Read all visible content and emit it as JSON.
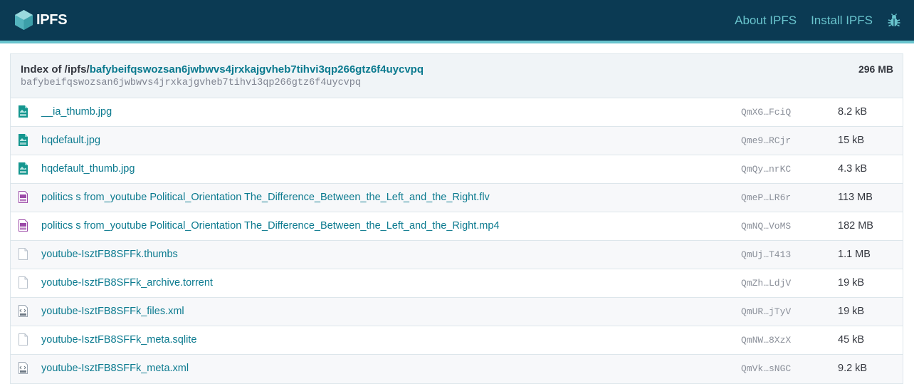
{
  "header": {
    "brand": "IPFS",
    "nav": [
      {
        "label": "About IPFS"
      },
      {
        "label": "Install IPFS"
      }
    ]
  },
  "index": {
    "prefix": "Index of /ipfs/",
    "cid": "bafybeifqswozsan6jwbwvs4jrxkajgvheb7tihvi3qp266gtz6f4uycvpq",
    "cid_mono": "bafybeifqswozsan6jwbwvs4jrxkajgvheb7tihvi3qp266gtz6f4uycvpq",
    "total_size": "296 MB"
  },
  "colors": {
    "header_bg": "#0b3a53",
    "accent": "#69c4cd",
    "link": "#0b7a8f",
    "jpg_icon": "#14968f",
    "video_icon": "#9c4aa8"
  },
  "files": [
    {
      "name": "__ia_thumb.jpg",
      "hash": "QmXG…FciQ",
      "size": "8.2 kB",
      "icon": "jpg-file-icon"
    },
    {
      "name": "hqdefault.jpg",
      "hash": "Qme9…RCjr",
      "size": "15 kB",
      "icon": "jpg-file-icon"
    },
    {
      "name": "hqdefault_thumb.jpg",
      "hash": "QmQy…nrKC",
      "size": "4.3 kB",
      "icon": "jpg-file-icon"
    },
    {
      "name": "politics s from_youtube Political_Orientation The_Difference_Between_the_Left_and_the_Right.flv",
      "hash": "QmeP…LR6r",
      "size": "113 MB",
      "icon": "flv-file-icon"
    },
    {
      "name": "politics s from_youtube Political_Orientation The_Difference_Between_the_Left_and_the_Right.mp4",
      "hash": "QmNQ…VoMS",
      "size": "182 MB",
      "icon": "mp4-file-icon"
    },
    {
      "name": "youtube-IsztFB8SFFk.thumbs",
      "hash": "QmUj…T413",
      "size": "1.1 MB",
      "icon": "blank-file-icon"
    },
    {
      "name": "youtube-IsztFB8SFFk_archive.torrent",
      "hash": "QmZh…LdjV",
      "size": "19 kB",
      "icon": "blank-file-icon"
    },
    {
      "name": "youtube-IsztFB8SFFk_files.xml",
      "hash": "QmUR…jTyV",
      "size": "19 kB",
      "icon": "xml-file-icon"
    },
    {
      "name": "youtube-IsztFB8SFFk_meta.sqlite",
      "hash": "QmNW…8XzX",
      "size": "45 kB",
      "icon": "blank-file-icon"
    },
    {
      "name": "youtube-IsztFB8SFFk_meta.xml",
      "hash": "QmVk…sNGC",
      "size": "9.2 kB",
      "icon": "xml-file-icon"
    }
  ]
}
